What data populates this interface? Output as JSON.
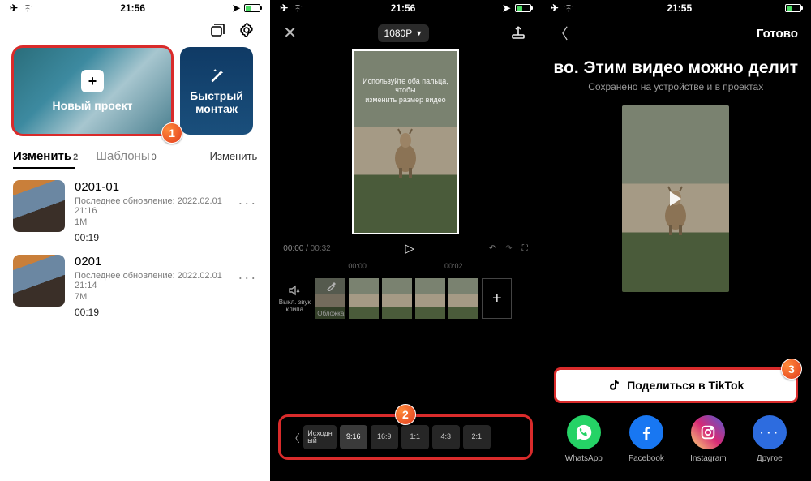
{
  "status": {
    "time": "21:56",
    "time_alt": "21:55"
  },
  "panel1": {
    "new_project": "Новый проект",
    "quick_montage": "Быстрый\nмонтаж",
    "tab_edit": "Изменить",
    "tab_edit_count": "2",
    "tab_templates": "Шаблоны",
    "tab_templates_count": "0",
    "edit_link": "Изменить",
    "projects": [
      {
        "name": "0201-01",
        "updated": "Последнее обновление: 2022.02.01 21:16",
        "size": "1M",
        "duration": "00:19"
      },
      {
        "name": "0201",
        "updated": "Последнее обновление: 2022.02.01 21:14",
        "size": "7M",
        "duration": "00:19"
      }
    ]
  },
  "panel2": {
    "resolution": "1080P",
    "hint": "Используйте оба пальца, чтобы\nизменить размер видео",
    "time_cur": "00:00",
    "time_total": "00:32",
    "scale": [
      "00:00",
      "00:02"
    ],
    "mute": "Выкл. звук\nклипа",
    "cover": "Обложка",
    "aspects": [
      "Исходн\nый",
      "9:16",
      "16:9",
      "1:1",
      "4:3",
      "2:1"
    ]
  },
  "panel3": {
    "done": "Готово",
    "title": "во. Этим видео можно делит",
    "subtitle": "Сохранено на устройстве и в проектах",
    "share_tiktok": "Поделиться в TikTok",
    "socials": [
      "WhatsApp",
      "Facebook",
      "Instagram",
      "Другое"
    ]
  },
  "badges": {
    "b1": "1",
    "b2": "2",
    "b3": "3"
  }
}
